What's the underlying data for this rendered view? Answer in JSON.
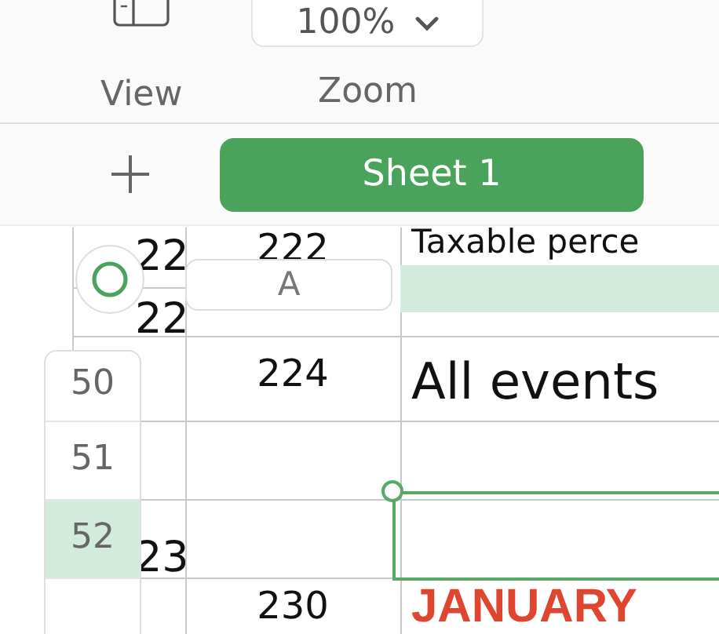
{
  "toolbar": {
    "items": [
      {
        "kind": "view",
        "label": "View"
      },
      {
        "kind": "zoom",
        "label": "Zoom",
        "value": "100%"
      }
    ]
  },
  "sheet_tabs": [
    {
      "label": "Sheet 1",
      "selected": true
    }
  ],
  "table": {
    "column_headers": [
      {
        "label": "A",
        "selected": false
      },
      {
        "selected": true
      }
    ],
    "row_headers": [
      {
        "label": "50",
        "selected": false
      },
      {
        "label": "51",
        "selected": false
      },
      {
        "label": "52",
        "selected": true
      }
    ],
    "behind_row_numbers": [
      "22",
      "22",
      "23"
    ],
    "rows": [
      {
        "number": "222",
        "kind": "plain",
        "cell": "Taxable perce"
      },
      {
        "number": "224",
        "kind": "plain",
        "cell": "All events"
      },
      {
        "number": "230",
        "kind": "heading",
        "cell": "JANUARY"
      }
    ]
  }
}
